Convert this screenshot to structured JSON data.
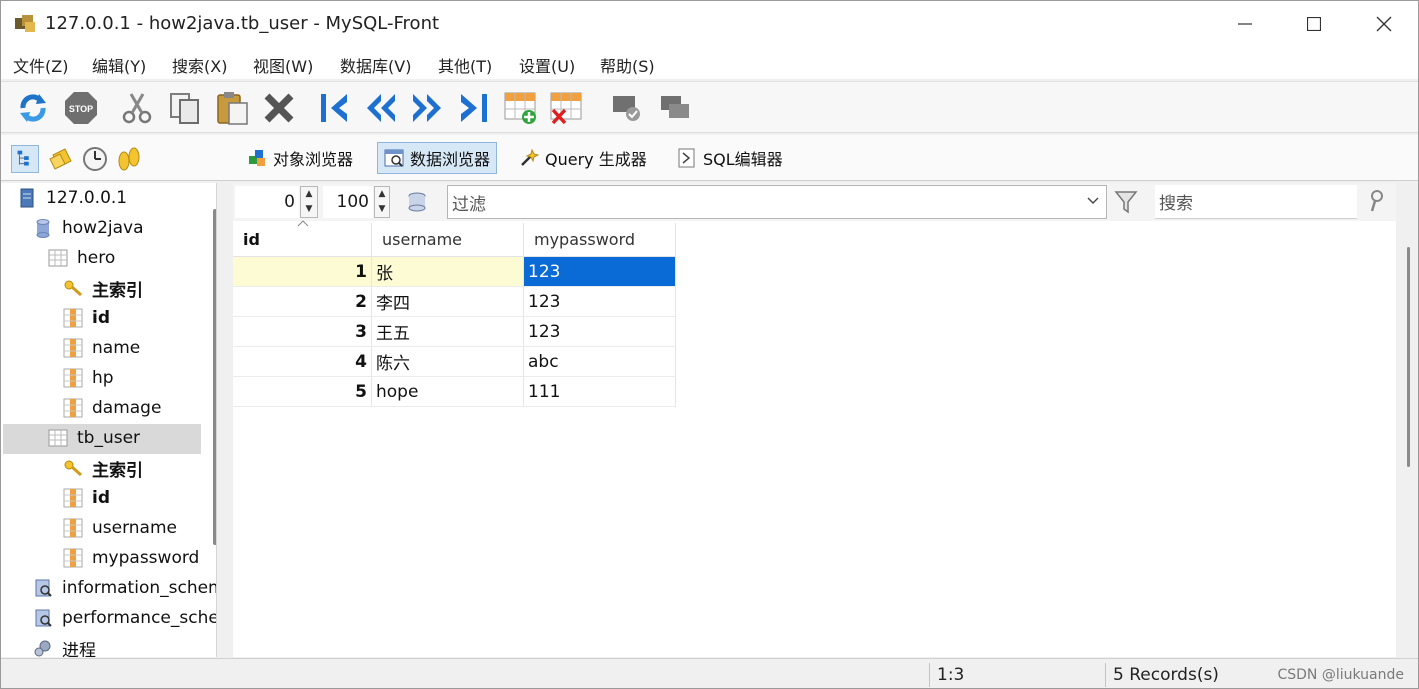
{
  "window": {
    "title": "127.0.0.1 - how2java.tb_user - MySQL-Front",
    "minimize": "—",
    "maximize": "☐",
    "close": "✕"
  },
  "menu": [
    "文件(Z)",
    "编辑(Y)",
    "搜索(X)",
    "视图(W)",
    "数据库(V)",
    "其他(T)",
    "设置(U)",
    "帮助(S)"
  ],
  "toolbar": {
    "icons": [
      "refresh-icon",
      "stop-icon",
      "cut-icon",
      "copy-icon",
      "paste-icon",
      "delete-icon",
      "first-record-icon",
      "previous-record-icon",
      "next-record-icon",
      "last-record-icon",
      "insert-row-icon",
      "delete-row-icon",
      "post-icon",
      "cancel-icon"
    ]
  },
  "viewbar": {
    "tabs": [
      {
        "label": "对象浏览器",
        "icon": "object-browser-icon"
      },
      {
        "label": "数据浏览器",
        "icon": "data-browser-icon",
        "active": true
      },
      {
        "label": "Query 生成器",
        "icon": "query-builder-icon"
      },
      {
        "label": "SQL编辑器",
        "icon": "sql-editor-icon"
      }
    ]
  },
  "tree": {
    "nodes": [
      {
        "label": "127.0.0.1",
        "type": "server"
      },
      {
        "label": "how2java",
        "type": "database"
      },
      {
        "label": "hero",
        "type": "table"
      },
      {
        "label": "主索引",
        "type": "key",
        "bold": true
      },
      {
        "label": "id",
        "type": "field",
        "bold": true
      },
      {
        "label": "name",
        "type": "field"
      },
      {
        "label": "hp",
        "type": "field"
      },
      {
        "label": "damage",
        "type": "field"
      },
      {
        "label": "tb_user",
        "type": "table",
        "selected": true
      },
      {
        "label": "主索引",
        "type": "key",
        "bold": true
      },
      {
        "label": "id",
        "type": "field",
        "bold": true
      },
      {
        "label": "username",
        "type": "field"
      },
      {
        "label": "mypassword",
        "type": "field"
      },
      {
        "label": "information_schema",
        "type": "system-db"
      },
      {
        "label": "performance_schema",
        "type": "system-db"
      },
      {
        "label": "进程",
        "type": "processes"
      }
    ]
  },
  "datagrid": {
    "offset": "0",
    "limit": "100",
    "filter_placeholder": "过滤",
    "search_placeholder": "搜索",
    "columns": [
      "id",
      "username",
      "mypassword"
    ],
    "rows": [
      [
        "1",
        "张",
        "123"
      ],
      [
        "2",
        "李四",
        "123"
      ],
      [
        "3",
        "王五",
        "123"
      ],
      [
        "4",
        "陈六",
        "abc"
      ],
      [
        "5",
        "hope",
        "111"
      ]
    ]
  },
  "status": {
    "position": "1:3",
    "records": "5 Records(s)",
    "watermark": "CSDN @liukuande"
  },
  "colors": {
    "selection": "#0a6ad6",
    "focus_row": "#fdfbd4",
    "active_tab": "#d6e7f6"
  }
}
